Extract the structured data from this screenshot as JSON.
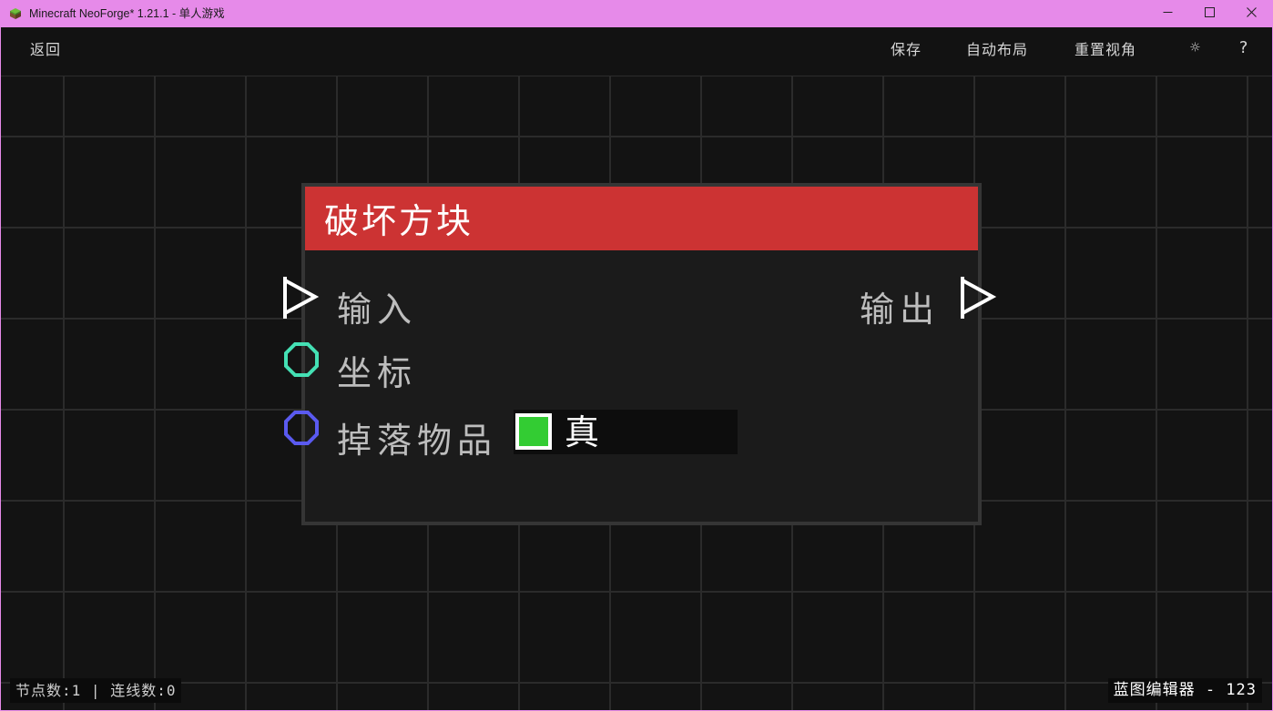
{
  "window": {
    "title": "Minecraft NeoForge* 1.21.1 - 单人游戏",
    "icon": "minecraft-grass-block-icon",
    "controls": {
      "minimize": "—",
      "maximize": "☐",
      "close": "✕"
    }
  },
  "toolbar": {
    "back_label": "返回",
    "save_label": "保存",
    "auto_layout_label": "自动布局",
    "reset_view_label": "重置视角",
    "settings_icon": "☼",
    "help_icon": "?"
  },
  "node": {
    "title": "破坏方块",
    "header_color": "#cc3333",
    "inputs": [
      {
        "label": "输入",
        "pin_type": "exec",
        "pin_icon": "exec-pin-icon"
      },
      {
        "label": "坐标",
        "pin_type": "position",
        "pin_color": "#44e0b4",
        "pin_icon": "data-pin-icon"
      },
      {
        "label": "掉落物品",
        "pin_type": "boolean",
        "pin_color": "#5a5af0",
        "pin_icon": "data-pin-icon"
      }
    ],
    "outputs": [
      {
        "label": "输出",
        "pin_type": "exec",
        "pin_icon": "exec-pin-icon"
      }
    ],
    "drop_items_value": {
      "checked": true,
      "label": "真",
      "color": "#33cc33"
    }
  },
  "status": {
    "node_count_label": "节点数:",
    "node_count": "1",
    "separator": "|",
    "connection_count_label": "连线数:",
    "connection_count": "0",
    "editor_name": "蓝图编辑器 - 123"
  }
}
